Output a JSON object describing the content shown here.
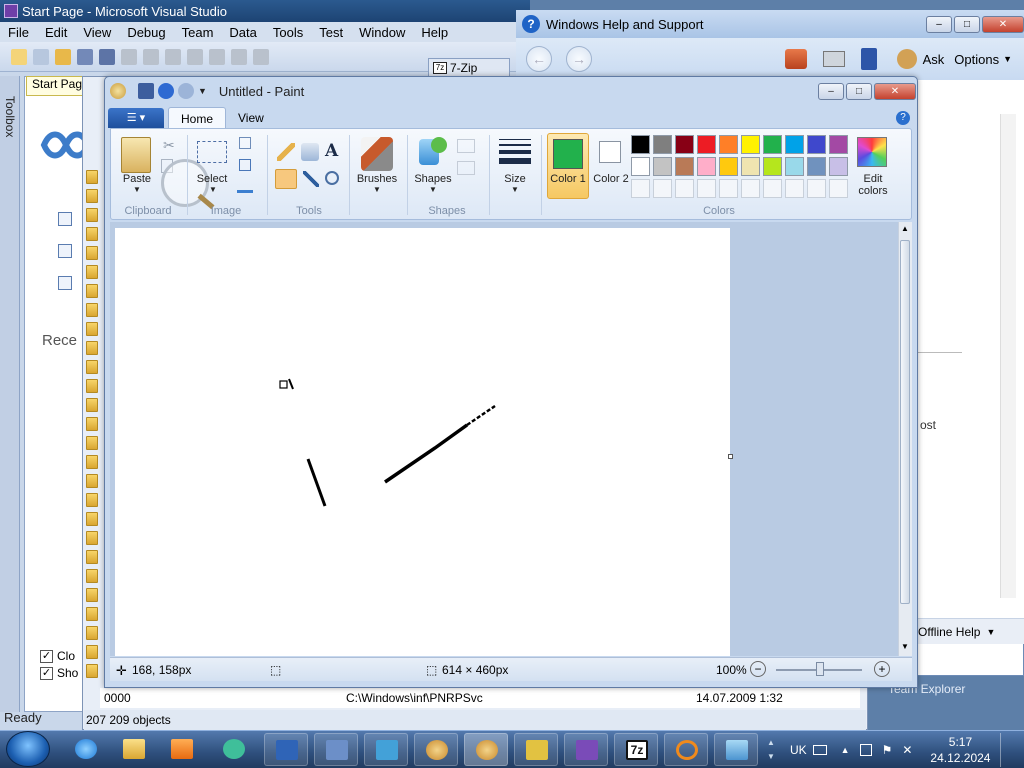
{
  "vs": {
    "title": "Start Page - Microsoft Visual Studio",
    "menu": [
      "File",
      "Edit",
      "View",
      "Debug",
      "Team",
      "Data",
      "Tools",
      "Test",
      "Window",
      "Help"
    ],
    "toolbox_label": "Toolbox",
    "doc_tab": "Start Pag",
    "recent_label": "Rece",
    "check1_label": "Clo",
    "check2_label": "Sho",
    "status": "Ready",
    "accent": "#6f3fa8"
  },
  "explorer": {
    "row_name": "0000",
    "row_path": "C:\\Windows\\inf\\PNRPSvc",
    "row_date": "14.07.2009 1:32",
    "status": "207 209 objects",
    "sevenzip_tab": "7-Zip"
  },
  "help": {
    "title": "Windows Help and Support",
    "ask": "Ask",
    "options": "Options",
    "body_fragment": "ost",
    "offline": "Offline Help",
    "team_explorer": "Team Explorer"
  },
  "paint": {
    "title": "Untitled - Paint",
    "tabs": [
      "Home",
      "View"
    ],
    "active_tab": "Home",
    "clipboard": {
      "paste": "Paste",
      "group": "Clipboard"
    },
    "image": {
      "select": "Select",
      "group": "Image"
    },
    "tools": {
      "group": "Tools",
      "text_glyph": "A"
    },
    "brushes": "Brushes",
    "shapes": {
      "label": "Shapes",
      "group": "Shapes"
    },
    "size": "Size",
    "color1": {
      "label": "Color 1",
      "value": "#22b14c"
    },
    "color2": {
      "label": "Color 2",
      "value": "#ffffff"
    },
    "colors_group": "Colors",
    "edit_colors": "Edit colors",
    "palette_row1": [
      "#000000",
      "#7f7f7f",
      "#880015",
      "#ed1c24",
      "#ff7f27",
      "#fff200",
      "#22b14c",
      "#00a2e8",
      "#3f48cc",
      "#a349a4"
    ],
    "palette_row2": [
      "#ffffff",
      "#c3c3c3",
      "#b97a57",
      "#ffaec9",
      "#ffc90e",
      "#efe4b0",
      "#b5e61d",
      "#99d9ea",
      "#7092be",
      "#c8bfe7"
    ],
    "status": {
      "cursor_pos": "168, 158px",
      "canvas_size": "614 × 460px",
      "zoom": "100%"
    }
  },
  "taskbar": {
    "lang": "UK",
    "time": "5:17",
    "date": "24.12.2024"
  }
}
